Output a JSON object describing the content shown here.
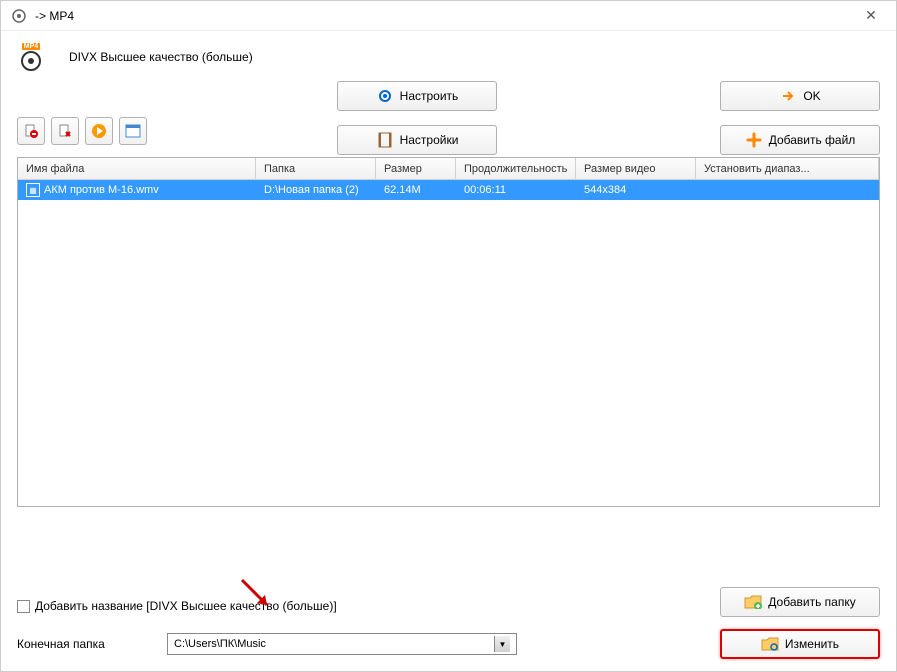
{
  "window": {
    "title": " -> MP4"
  },
  "quality_text": "DIVX Высшее качество (больше)",
  "buttons": {
    "configure": "Настроить",
    "ok": "OK",
    "settings": "Настройки",
    "add_file": "Добавить файл",
    "add_folder": "Добавить папку",
    "change": "Изменить"
  },
  "table": {
    "headers": {
      "filename": "Имя файла",
      "folder": "Папка",
      "size": "Размер",
      "duration": "Продолжительность",
      "video_size": "Размер видео",
      "set_range": "Установить диапаз..."
    },
    "row": {
      "filename": "АКМ против M-16.wmv",
      "folder": "D:\\Новая папка (2)",
      "size": "62.14M",
      "duration": "00:06:11",
      "video_size": "544x384",
      "set_range": ""
    }
  },
  "checkbox_label": "Добавить название [DIVX Высшее качество (больше)]",
  "dest_folder_label": "Конечная папка",
  "dest_folder_value": "C:\\Users\\ПК\\Music"
}
